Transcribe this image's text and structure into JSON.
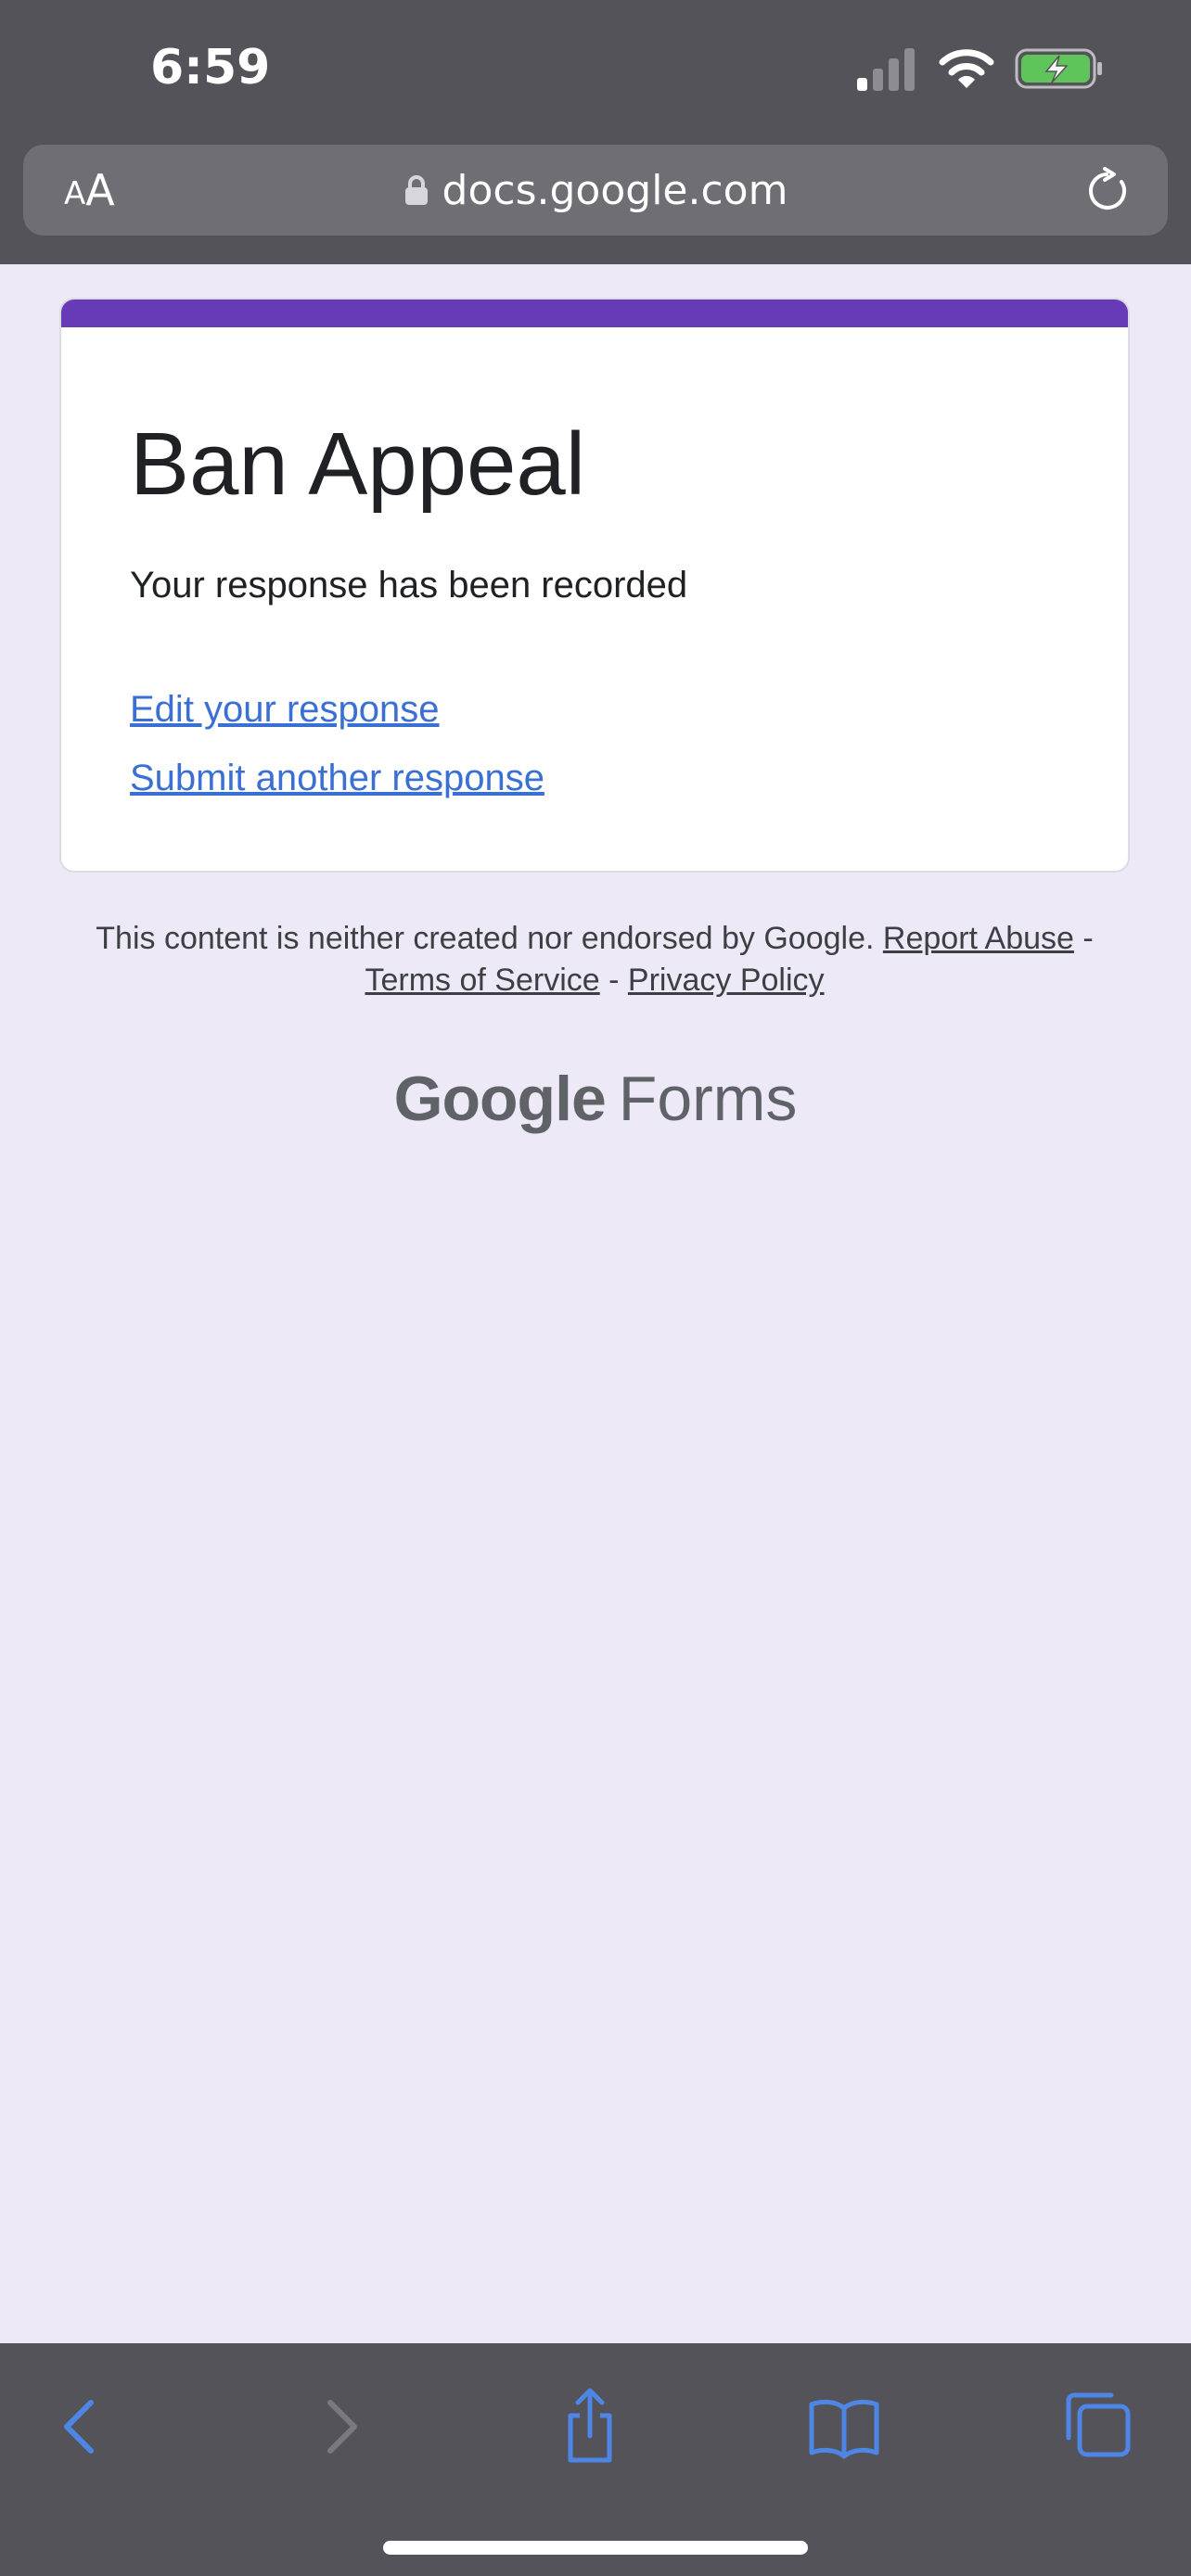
{
  "status_bar": {
    "time": "6:59"
  },
  "browser": {
    "aa_small": "A",
    "aa_large": "A",
    "url": "docs.google.com"
  },
  "form": {
    "title": "Ban Appeal",
    "confirmation": "Your response has been recorded",
    "edit_link": "Edit your response",
    "submit_link": "Submit another response",
    "accent_color": "#673ab7"
  },
  "footer": {
    "disclaimer": "This content is neither created nor endorsed by Google.",
    "report_abuse": "Report Abuse",
    "separator": "-",
    "terms": "Terms of Service",
    "privacy": "Privacy Policy",
    "logo_google": "Google",
    "logo_forms": "Forms"
  },
  "colors": {
    "chrome": "#545359",
    "url_bar": "#6f6e74",
    "page_bg": "#ede9f6",
    "link": "#3a6fd4",
    "toolbar_icon": "#4e86e6",
    "toolbar_icon_disabled": "#7a797f",
    "battery_green": "#5fc55a"
  },
  "icons": {
    "signal": "cellular-signal-icon",
    "wifi": "wifi-icon",
    "battery": "battery-charging-icon",
    "lock": "lock-icon",
    "reload": "reload-icon",
    "back": "back-chevron-icon",
    "forward": "forward-chevron-icon",
    "share": "share-icon",
    "bookmarks": "bookmarks-book-icon",
    "tabs": "tabs-icon"
  }
}
